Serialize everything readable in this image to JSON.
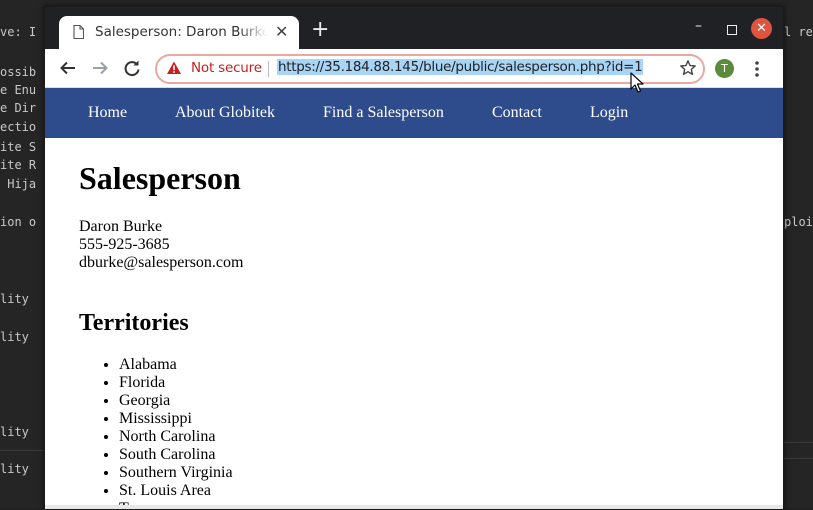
{
  "terminal": {
    "lines": [
      "ve: I",
      "ossib",
      "e Enu",
      "e Dir",
      "ectio",
      "ite S",
      "ite R",
      " Hija",
      "ion o",
      "lity",
      "lity",
      "lity",
      "lity"
    ],
    "right_lines": [
      "l red",
      "ploit"
    ]
  },
  "browser": {
    "tab": {
      "title": "Salesperson: Daron Burke",
      "close_icon": "✕"
    },
    "new_tab_icon": "+",
    "window_controls": {
      "minimize": "–",
      "close": "✕"
    },
    "address_bar": {
      "security_label": "Not secure",
      "url": "https://35.184.88.145/blue/public/salesperson.php?id=1"
    },
    "profile_initial": "T",
    "colors": {
      "nav_bar": "#2e4c8c",
      "not_secure": "#c5221f",
      "url_highlight": "#a8d4f5"
    }
  },
  "site": {
    "nav": [
      "Home",
      "About Globitek",
      "Find a Salesperson",
      "Contact",
      "Login"
    ],
    "page_title": "Salesperson",
    "contact": {
      "name": "Daron Burke",
      "phone": "555-925-3685",
      "email": "dburke@salesperson.com"
    },
    "territories_heading": "Territories",
    "territories": [
      "Alabama",
      "Florida",
      "Georgia",
      "Mississippi",
      "North Carolina",
      "South Carolina",
      "Southern Virginia",
      "St. Louis Area",
      "Tennessee"
    ]
  }
}
